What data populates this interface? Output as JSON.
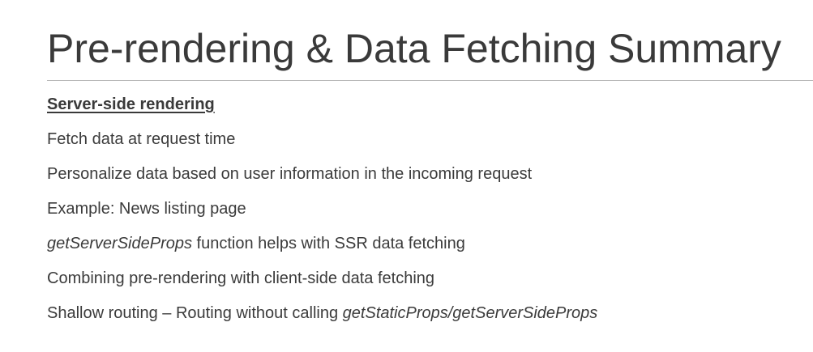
{
  "slide": {
    "title": "Pre-rendering & Data Fetching Summary",
    "section_heading": "Server-side rendering",
    "bullets": {
      "b1": "Fetch data at request time",
      "b2": "Personalize data based on user information in the incoming request",
      "b3": "Example: News listing page",
      "b4_italic": "getServerSideProps",
      "b4_rest": " function helps with SSR data fetching",
      "b5": "Combining pre-rendering with client-side data fetching",
      "b6_plain": "Shallow routing – Routing without calling ",
      "b6_italic": "getStaticProps/getServerSideProps"
    }
  }
}
